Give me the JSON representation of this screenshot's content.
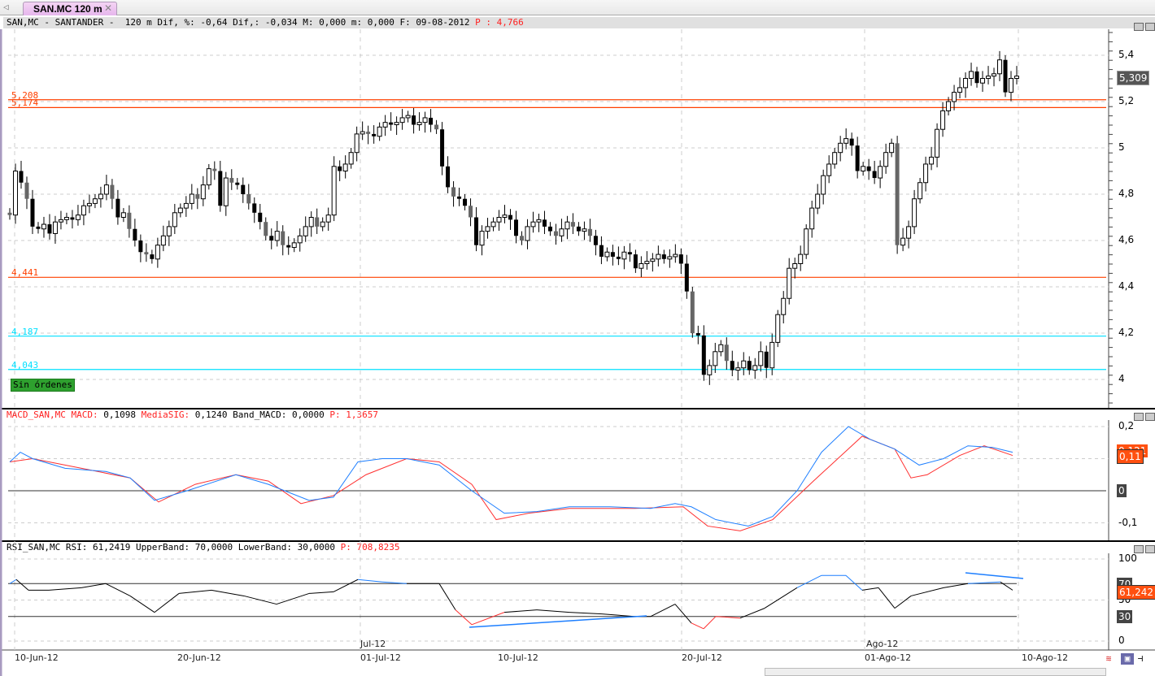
{
  "tab": {
    "title": "SAN.MC 120 m"
  },
  "header": {
    "info": "SAN,MC - SANTANDER -  120 m Dif, %: -0,64 Dif,: -0,034 M: 0,000 m: 0,000 F: 09-08-2012 ",
    "p": "P : 4,766"
  },
  "macd_header": {
    "a": "MACD_SAN,MC MACD:",
    "b": " 0,1098 ",
    "c": "MediaSIG:",
    "d": " 0,1240 Band_MACD: 0,0000 ",
    "e": "P: 1,3657"
  },
  "rsi_header": {
    "a": "RSI_SAN,MC RSI: 61,2419 UpperBand: 70,0000 LowerBand: 30,0000 ",
    "b": "P: 708,8235"
  },
  "levels": [
    {
      "label": "5,208",
      "value": 5.208,
      "color": "#ff4000"
    },
    {
      "label": "5,174",
      "value": 5.174,
      "color": "#ff4000"
    },
    {
      "label": "4,441",
      "value": 4.441,
      "color": "#ff4000"
    },
    {
      "label": "4,187",
      "value": 4.187,
      "color": "#00e0ff"
    },
    {
      "label": "4,043",
      "value": 4.043,
      "color": "#00e0ff"
    }
  ],
  "orders_badge": "Sin órdenes",
  "price_axis": {
    "ticks": [
      "5,4",
      "5,2",
      "5",
      "4,8",
      "4,6",
      "4,4",
      "4,2",
      "4"
    ],
    "last": "5,309"
  },
  "macd_axis": {
    "ticks": [
      "0,2",
      "0",
      "-0,1"
    ],
    "tag1": "0,121",
    "tag2": "0,11",
    "zero": "0"
  },
  "rsi_axis": {
    "ticks": [
      "100",
      "50",
      "0"
    ],
    "upper": "70",
    "lower": "30",
    "last": "61,242"
  },
  "x_axis": {
    "labels": [
      "10-Jun-12",
      "20-Jun-12",
      "01-Jul-12",
      "10-Jul-12",
      "20-Jul-12",
      "01-Ago-12",
      "10-Ago-12"
    ],
    "months": [
      "Jul-12",
      "Ago-12"
    ]
  },
  "colors": {
    "up": "#ffffff",
    "down": "#000000",
    "macd": "#1e7fff",
    "signal": "#ff3030",
    "rsi": "#000000",
    "tag": "#ff5010"
  },
  "chart_data": {
    "type": "candlestick",
    "closes": [
      4.71,
      4.9,
      4.85,
      4.78,
      4.66,
      4.65,
      4.67,
      4.63,
      4.68,
      4.69,
      4.7,
      4.69,
      4.71,
      4.75,
      4.76,
      4.78,
      4.8,
      4.84,
      4.78,
      4.7,
      4.72,
      4.65,
      4.6,
      4.55,
      4.54,
      4.52,
      4.58,
      4.62,
      4.66,
      4.72,
      4.74,
      4.76,
      4.8,
      4.78,
      4.84,
      4.91,
      4.9,
      4.75,
      4.87,
      4.85,
      4.84,
      4.8,
      4.76,
      4.72,
      4.68,
      4.62,
      4.6,
      4.64,
      4.58,
      4.57,
      4.59,
      4.62,
      4.66,
      4.7,
      4.66,
      4.68,
      4.71,
      4.92,
      4.9,
      4.93,
      4.98,
      5.06,
      5.07,
      5.06,
      5.05,
      5.09,
      5.11,
      5.1,
      5.11,
      5.13,
      5.14,
      5.1,
      5.11,
      5.13,
      5.1,
      5.08,
      4.92,
      4.83,
      4.79,
      4.78,
      4.75,
      4.7,
      4.58,
      4.64,
      4.66,
      4.68,
      4.7,
      4.71,
      4.69,
      4.62,
      4.6,
      4.66,
      4.68,
      4.69,
      4.66,
      4.64,
      4.62,
      4.65,
      4.68,
      4.66,
      4.64,
      4.65,
      4.62,
      4.58,
      4.53,
      4.55,
      4.53,
      4.52,
      4.55,
      4.54,
      4.48,
      4.5,
      4.51,
      4.52,
      4.54,
      4.52,
      4.53,
      4.54,
      4.5,
      4.38,
      4.2,
      4.19,
      4.02,
      4.06,
      4.12,
      4.15,
      4.08,
      4.04,
      4.05,
      4.08,
      4.04,
      4.06,
      4.12,
      4.05,
      4.16,
      4.28,
      4.35,
      4.48,
      4.5,
      4.54,
      4.65,
      4.74,
      4.8,
      4.88,
      4.93,
      4.98,
      5.02,
      5.04,
      5.01,
      4.9,
      4.92,
      4.9,
      4.87,
      4.92,
      4.98,
      5.02,
      4.58,
      4.61,
      4.66,
      4.78,
      4.85,
      4.93,
      4.96,
      5.08,
      5.16,
      5.2,
      5.24,
      5.26,
      5.3,
      5.33,
      5.28,
      5.3,
      5.31,
      5.32,
      5.38,
      5.24,
      5.3,
      5.31
    ],
    "first_open": 4.72,
    "ylim": [
      3.85,
      5.6
    ],
    "macd": [
      [
        12,
        0.09
      ],
      [
        25,
        0.12
      ],
      [
        40,
        0.1
      ],
      [
        80,
        0.07
      ],
      [
        130,
        0.06
      ],
      [
        160,
        0.04
      ],
      [
        190,
        -0.03
      ],
      [
        230,
        0.0
      ],
      [
        290,
        0.05
      ],
      [
        330,
        0.02
      ],
      [
        380,
        -0.03
      ],
      [
        410,
        -0.02
      ],
      [
        440,
        0.09
      ],
      [
        470,
        0.1
      ],
      [
        500,
        0.1
      ],
      [
        540,
        0.08
      ],
      [
        580,
        0.0
      ],
      [
        620,
        -0.07
      ],
      [
        660,
        -0.065
      ],
      [
        700,
        -0.05
      ],
      [
        750,
        -0.05
      ],
      [
        800,
        -0.055
      ],
      [
        830,
        -0.04
      ],
      [
        850,
        -0.05
      ],
      [
        880,
        -0.09
      ],
      [
        920,
        -0.11
      ],
      [
        950,
        -0.08
      ],
      [
        980,
        0.0
      ],
      [
        1010,
        0.12
      ],
      [
        1043,
        0.2
      ],
      [
        1070,
        0.16
      ],
      [
        1100,
        0.13
      ],
      [
        1130,
        0.08
      ],
      [
        1160,
        0.1
      ],
      [
        1190,
        0.14
      ],
      [
        1220,
        0.135
      ],
      [
        1245,
        0.12
      ]
    ],
    "signal": [
      [
        12,
        0.09
      ],
      [
        40,
        0.1
      ],
      [
        80,
        0.08
      ],
      [
        120,
        0.06
      ],
      [
        160,
        0.04
      ],
      [
        195,
        -0.035
      ],
      [
        240,
        0.02
      ],
      [
        290,
        0.05
      ],
      [
        330,
        0.03
      ],
      [
        370,
        -0.04
      ],
      [
        410,
        -0.015
      ],
      [
        450,
        0.05
      ],
      [
        500,
        0.1
      ],
      [
        540,
        0.09
      ],
      [
        580,
        0.02
      ],
      [
        610,
        -0.09
      ],
      [
        650,
        -0.07
      ],
      [
        700,
        -0.055
      ],
      [
        780,
        -0.055
      ],
      [
        840,
        -0.05
      ],
      [
        870,
        -0.11
      ],
      [
        910,
        -0.125
      ],
      [
        950,
        -0.09
      ],
      [
        1000,
        0.03
      ],
      [
        1060,
        0.17
      ],
      [
        1100,
        0.13
      ],
      [
        1120,
        0.04
      ],
      [
        1140,
        0.05
      ],
      [
        1180,
        0.11
      ],
      [
        1210,
        0.14
      ],
      [
        1245,
        0.11
      ]
    ],
    "rsi": [
      [
        12,
        70
      ],
      [
        20,
        75
      ],
      [
        35,
        62
      ],
      [
        60,
        62
      ],
      [
        100,
        65
      ],
      [
        130,
        70
      ],
      [
        160,
        55
      ],
      [
        190,
        35
      ],
      [
        220,
        58
      ],
      [
        260,
        62
      ],
      [
        300,
        55
      ],
      [
        340,
        45
      ],
      [
        380,
        58
      ],
      [
        410,
        60
      ],
      [
        440,
        75
      ],
      [
        470,
        72
      ],
      [
        500,
        70
      ],
      [
        540,
        70
      ],
      [
        560,
        38
      ],
      [
        580,
        20
      ],
      [
        620,
        35
      ],
      [
        660,
        38
      ],
      [
        700,
        35
      ],
      [
        740,
        33
      ],
      [
        780,
        30
      ],
      [
        800,
        30
      ],
      [
        830,
        45
      ],
      [
        850,
        22
      ],
      [
        865,
        15
      ],
      [
        880,
        30
      ],
      [
        910,
        28
      ],
      [
        940,
        40
      ],
      [
        980,
        65
      ],
      [
        1010,
        80
      ],
      [
        1040,
        80
      ],
      [
        1060,
        62
      ],
      [
        1080,
        65
      ],
      [
        1100,
        40
      ],
      [
        1120,
        55
      ],
      [
        1160,
        65
      ],
      [
        1190,
        70
      ],
      [
        1230,
        72
      ],
      [
        1245,
        62
      ]
    ]
  }
}
